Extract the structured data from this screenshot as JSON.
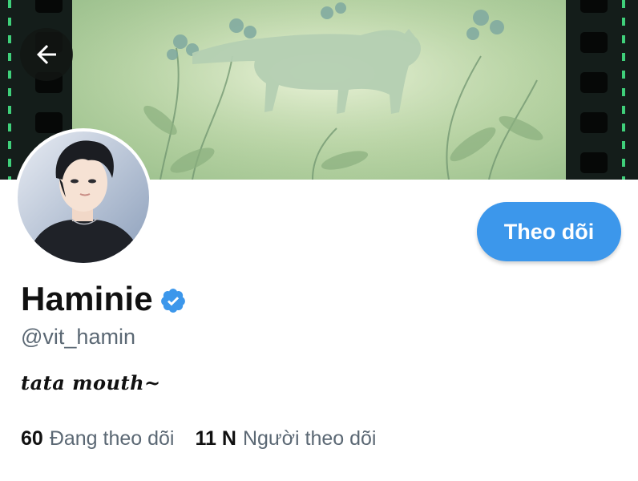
{
  "header": {
    "back_icon": "arrow-left-icon"
  },
  "profile": {
    "display_name": "Haminie",
    "verified_icon": "verified-badge-icon",
    "handle": "@vit_hamin",
    "bio": "tata mouth~",
    "follow_label": "Theo dõi"
  },
  "stats": {
    "following_count": "60",
    "following_label": "Đang theo dõi",
    "followers_count": "11 N",
    "followers_label": "Người theo dõi"
  },
  "colors": {
    "accent": "#3c97eb",
    "secondary_text": "#5b6874",
    "film_dash": "#3fd07a"
  }
}
